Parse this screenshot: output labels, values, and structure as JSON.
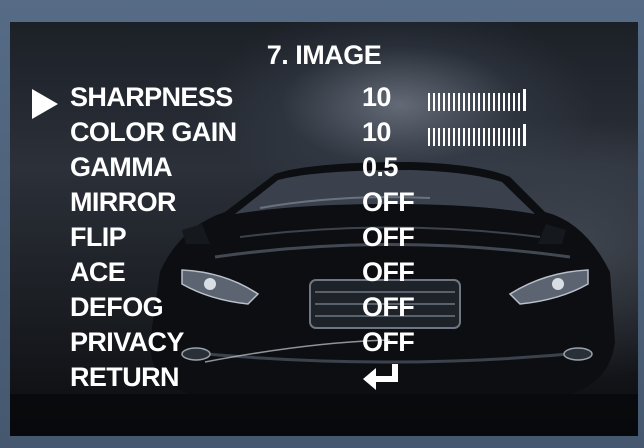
{
  "menu": {
    "title": "7. IMAGE",
    "selected_index": 0,
    "items": [
      {
        "label": "SHARPNESS",
        "value": "10",
        "level": 1.0
      },
      {
        "label": "COLOR GAIN",
        "value": "10",
        "level": 1.0
      },
      {
        "label": "GAMMA",
        "value": "0.5"
      },
      {
        "label": "MIRROR",
        "value": "OFF"
      },
      {
        "label": "FLIP",
        "value": "OFF"
      },
      {
        "label": "ACE",
        "value": "OFF"
      },
      {
        "label": "DEFOG",
        "value": "OFF"
      },
      {
        "label": "PRIVACY",
        "value": "OFF"
      },
      {
        "label": "RETURN",
        "value_icon": "return-arrow-icon"
      }
    ]
  },
  "colors": {
    "text": "#ffffff",
    "frame": "#4b5e78",
    "background": "#1c2027"
  }
}
